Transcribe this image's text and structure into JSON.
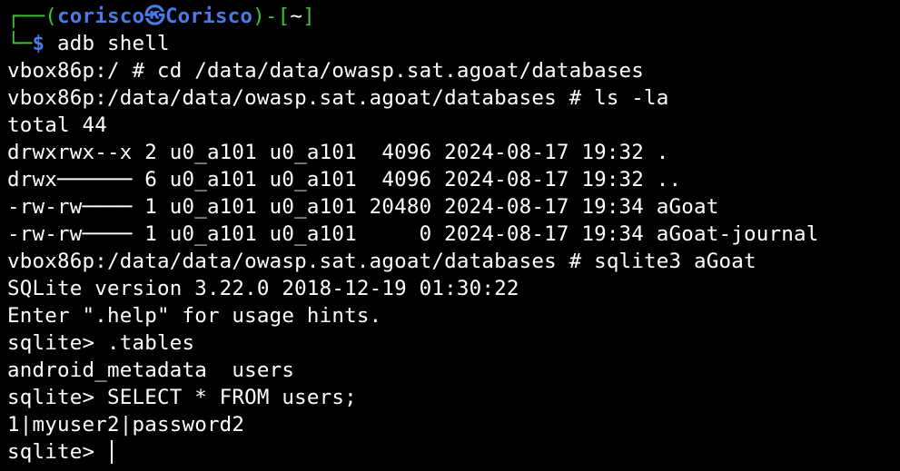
{
  "prompt": {
    "corner_top": "┌──(",
    "user": "corisco",
    "at_symbol": "㉿",
    "host": "Corisco",
    "mid": ")-[",
    "cwd": "~",
    "end": "]",
    "corner_bottom": "└─",
    "dollar": "$",
    "command": " adb shell"
  },
  "output_lines": [
    "vbox86p:/ # cd /data/data/owasp.sat.agoat/databases",
    "vbox86p:/data/data/owasp.sat.agoat/databases # ls -la",
    "total 44",
    "drwxrwx--x 2 u0_a101 u0_a101  4096 2024-08-17 19:32 .",
    "drwx────── 6 u0_a101 u0_a101  4096 2024-08-17 19:32 ..",
    "-rw-rw──── 1 u0_a101 u0_a101 20480 2024-08-17 19:34 aGoat",
    "-rw-rw──── 1 u0_a101 u0_a101     0 2024-08-17 19:34 aGoat-journal",
    "vbox86p:/data/data/owasp.sat.agoat/databases # sqlite3 aGoat",
    "SQLite version 3.22.0 2018-12-19 01:30:22",
    "Enter \".help\" for usage hints.",
    "sqlite> .tables",
    "android_metadata  users",
    "sqlite> SELECT * FROM users;",
    "1|myuser2|password2"
  ],
  "current_prompt": "sqlite> ",
  "colors": {
    "background": "#000000",
    "prompt_green": "#3fc234",
    "prompt_blue": "#4a79e8",
    "text": "#ffffff"
  }
}
